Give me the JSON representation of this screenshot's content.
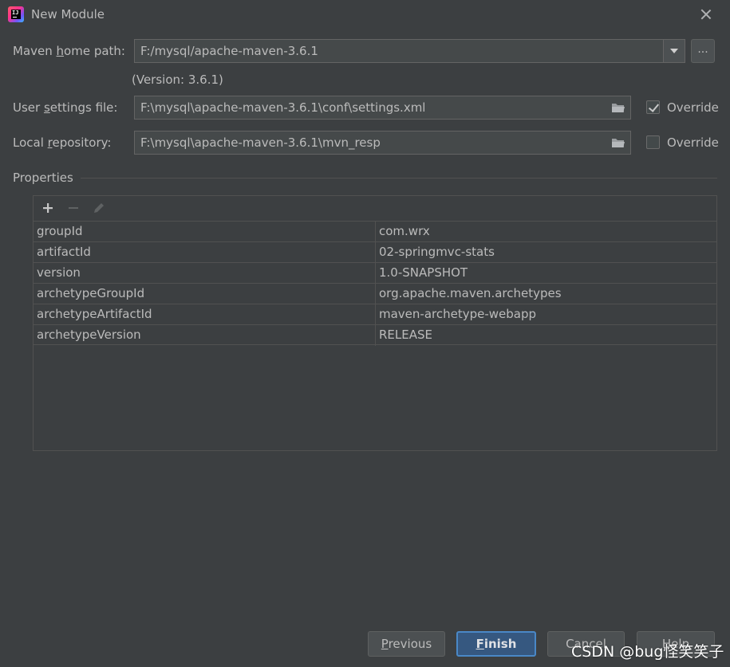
{
  "window": {
    "title": "New Module"
  },
  "maven": {
    "home_label_pre": "Maven ",
    "home_label_u": "h",
    "home_label_post": "ome path:",
    "home_value": "F:/mysql/apache-maven-3.6.1",
    "browse_label": "...",
    "version_text": "(Version: 3.6.1)",
    "settings_label_pre": "User ",
    "settings_label_u": "s",
    "settings_label_post": "ettings file:",
    "settings_value": "F:\\mysql\\apache-maven-3.6.1\\conf\\settings.xml",
    "settings_override": true,
    "repo_label_pre": "Local ",
    "repo_label_u": "r",
    "repo_label_post": "epository:",
    "repo_value": "F:\\mysql\\apache-maven-3.6.1\\mvn_resp",
    "repo_override": false,
    "override_label": "Override"
  },
  "properties": {
    "title": "Properties",
    "rows": [
      {
        "key": "groupId",
        "value": "com.wrx"
      },
      {
        "key": "artifactId",
        "value": "02-springmvc-stats"
      },
      {
        "key": "version",
        "value": "1.0-SNAPSHOT"
      },
      {
        "key": "archetypeGroupId",
        "value": "org.apache.maven.archetypes"
      },
      {
        "key": "archetypeArtifactId",
        "value": "maven-archetype-webapp"
      },
      {
        "key": "archetypeVersion",
        "value": "RELEASE"
      }
    ]
  },
  "buttons": {
    "previous_u": "P",
    "previous_rest": "revious",
    "finish_u": "F",
    "finish_rest": "inish",
    "cancel": "Cancel",
    "help": "Help"
  },
  "watermark": "CSDN @bug怪笑笑子",
  "colors": {
    "background": "#3c3f41",
    "field_bg": "#45494a",
    "primary_button": "#365880",
    "primary_border": "#4a88c7",
    "text": "#bbbbbb"
  }
}
